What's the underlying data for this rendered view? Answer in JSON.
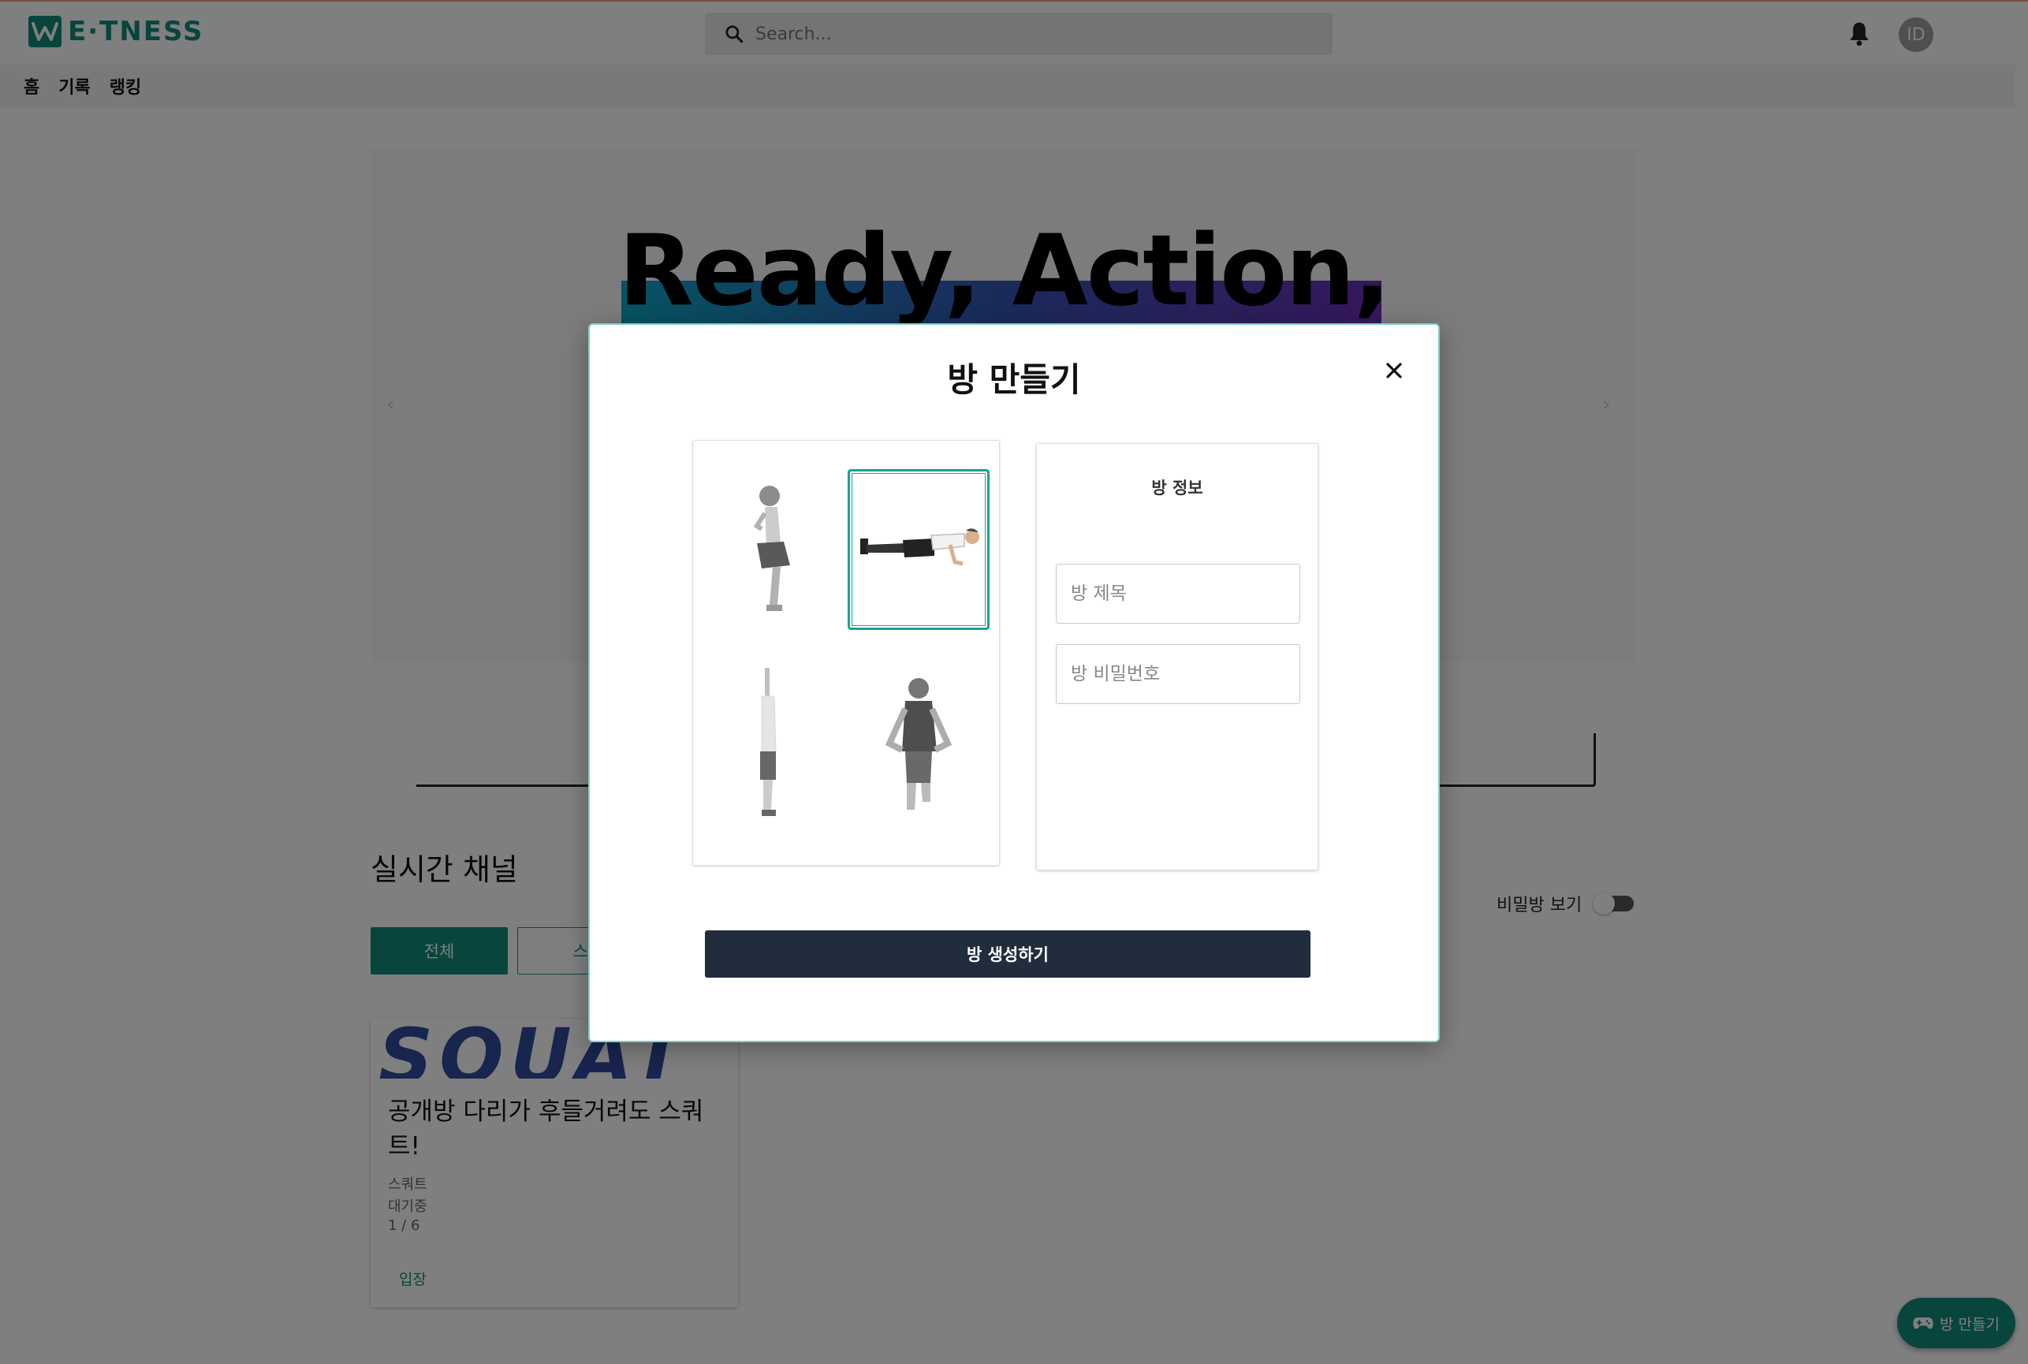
{
  "header": {
    "logo_text": "E·TNESS",
    "search_placeholder": "Search...",
    "avatar_initials": "ID"
  },
  "nav": {
    "items": [
      {
        "label": "홈"
      },
      {
        "label": "기록"
      },
      {
        "label": "랭킹"
      }
    ]
  },
  "banner": {
    "title": "Ready, Action,"
  },
  "live": {
    "section_title": "실시간 채널",
    "secret_toggle_label": "비밀방 보기",
    "filters": [
      {
        "label": "전체"
      },
      {
        "label": "스쿼"
      }
    ],
    "room": {
      "thumb_text": "SQUAT",
      "title": "공개방 다리가 후들거려도 스쿼트!",
      "category": "스쿼트",
      "status": "대기중",
      "count": "1 / 6",
      "enter_label": "입장"
    }
  },
  "modal": {
    "title": "방 만들기",
    "info_title": "방 정보",
    "room_title_placeholder": "방 제목",
    "room_password_placeholder": "방 비밀번호",
    "create_label": "방 생성하기",
    "exercises": [
      {
        "name": "squat",
        "selected": false
      },
      {
        "name": "push-up",
        "selected": true
      },
      {
        "name": "lunge-side",
        "selected": false
      },
      {
        "name": "lunge-front",
        "selected": false
      }
    ]
  },
  "fab": {
    "label": "방 만들기",
    "icon": "gamepad-icon"
  },
  "colors": {
    "brand": "#0f8a7a",
    "create_button": "#212d3d",
    "selected_border": "#19a394"
  }
}
